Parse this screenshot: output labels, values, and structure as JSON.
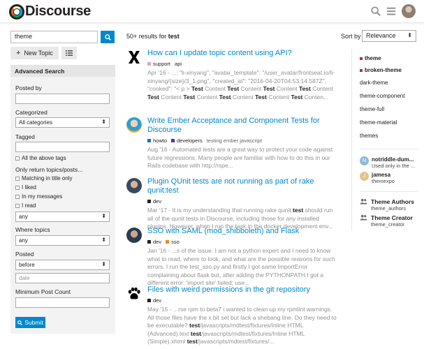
{
  "header": {
    "logo_text": "Discourse",
    "icons": [
      "search-icon",
      "hamburger-icon",
      "user-avatar"
    ]
  },
  "search": {
    "query": "theme",
    "button_icon": "search-icon"
  },
  "actions": {
    "new_topic_label": "New Topic",
    "new_topic_icon": "plus-icon",
    "bulk_icon": "list-icon"
  },
  "advanced": {
    "title": "Advanced Search",
    "posted_by_label": "Posted by",
    "categorized_label": "Categorized",
    "category_value": "All categories",
    "tagged_label": "Tagged",
    "all_tags_label": "All the above tags",
    "only_return_label": "Only return topics/posts...",
    "matching_title_label": "Matching in title only",
    "liked_label": "I liked",
    "in_messages_label": "In my messages",
    "read_label": "I read",
    "any_value_1": "any",
    "where_topics_label": "Where topics",
    "any_value_2": "any",
    "posted_label": "Posted",
    "posted_value": "before",
    "date_placeholder": "date",
    "min_post_label": "Minimum Post Count",
    "submit_label": "Submit"
  },
  "results_header": {
    "count_text": "50+ results for",
    "query": "test",
    "sort_label": "Sort by",
    "sort_value": "Relevance"
  },
  "results": [
    {
      "icon": "x-logo",
      "title": "How can I update topic content using API?",
      "category": "support",
      "category_color": "#e1a3c2",
      "subcategory": "api",
      "tags": "",
      "date": "Apr '16",
      "blurb_parts": [
        "Apr '16 - ...: \"li-xinyang\", \"avatar_template\": \"/user_avatar/frontseat.io/li-xinyang/{size}/3_1.png\", \"created_at\": \"2016-04-20T04:53:14.587Z\", \"cooked\": \"< p > ",
        "Test",
        " Content ",
        "Test",
        " Content ",
        "Test",
        " Content ",
        "Test",
        " Content ",
        "Test",
        " Content ",
        "Test",
        " Content ",
        "Test",
        " Content ",
        "Test",
        " Content ",
        "Test",
        " Conten..."
      ]
    },
    {
      "icon": "avatar",
      "title": "Write Ember Acceptance and Component Tests for Discourse",
      "category": "howto",
      "category_color": "#0e76bd",
      "subcategory": "developers",
      "subcategory_color": "#3b3bb0",
      "tags": "testing ember javascript",
      "blurb": "Aug '16 - Automated tests are a great way to protect your code against future regressions. Many people are familiar with how to do this in our Rails codebase with http://rspe..."
    },
    {
      "icon": "avatar",
      "title": "Plugin QUnit tests are not running as part of rake qunit:test",
      "category": "dev",
      "category_color": "#222222",
      "blurb_parts": [
        "Mar '17 - It is my understanding that running rake qunit:",
        "test",
        " should run all of the qunit tests in Discourse, including those for any installed plugins. However, when I run the task in the docker development env..."
      ]
    },
    {
      "icon": "avatar",
      "title": "SSO with SAML (mod_shibboleth) and Flask",
      "category": "dev",
      "category_color": "#222222",
      "subcategory": "sso",
      "subcategory_color": "#e98a27",
      "blurb": "Jan '16 - ...s of the issue. I am not a python expert and I need to know what to read, where to look, and what are the possible reasons for such errors. I run the test_sso.py and firstly I got same ImportError complaining about flask but, after adding the PYTHONPATH I got a different error: 'import site' failed; use..."
    },
    {
      "icon": "paw-logo",
      "title": "Files with weird permissions in the git repository",
      "category": "dev",
      "category_color": "#222222",
      "blurb_parts": [
        "May '15 - ...rse rpm to beta7 i wanted to clean up my rpmlint warnings. All those files have the x bit set but lack a shebang line. Do they need to be executable? ",
        "test",
        "/javascripts/mdtest/fixtures/Inline HTML (Advanced).text ",
        "test",
        "/javascripts/mdtest/fixtures/Inline HTML (Simple).xhtml ",
        "test",
        "/javascripts/mdtest/fixtures/..."
      ]
    }
  ],
  "sidebar": {
    "tags": [
      {
        "label": "theme",
        "color": "#a8334a",
        "bold": true
      },
      {
        "label": "broken-theme",
        "color": "#a8334a",
        "bold": true
      },
      {
        "label": "dark-theme"
      },
      {
        "label": "theme-component"
      },
      {
        "label": "theme-full"
      },
      {
        "label": "theme-material"
      },
      {
        "label": "themes"
      }
    ],
    "users": [
      {
        "initial": "N",
        "color": "#8ebadb",
        "name": "notriddle-dum...",
        "sub": "Used only in the ..."
      },
      {
        "initial": "J",
        "color": "#e1c48c",
        "name": "jamesa",
        "sub": "themexpo"
      }
    ],
    "groups": [
      {
        "name": "Theme Authors",
        "sub": "theme_authors"
      },
      {
        "name": "Theme Creator",
        "sub": "theme_creator"
      }
    ]
  },
  "colors": {
    "accent": "#0088cc",
    "muted": "#919191"
  }
}
